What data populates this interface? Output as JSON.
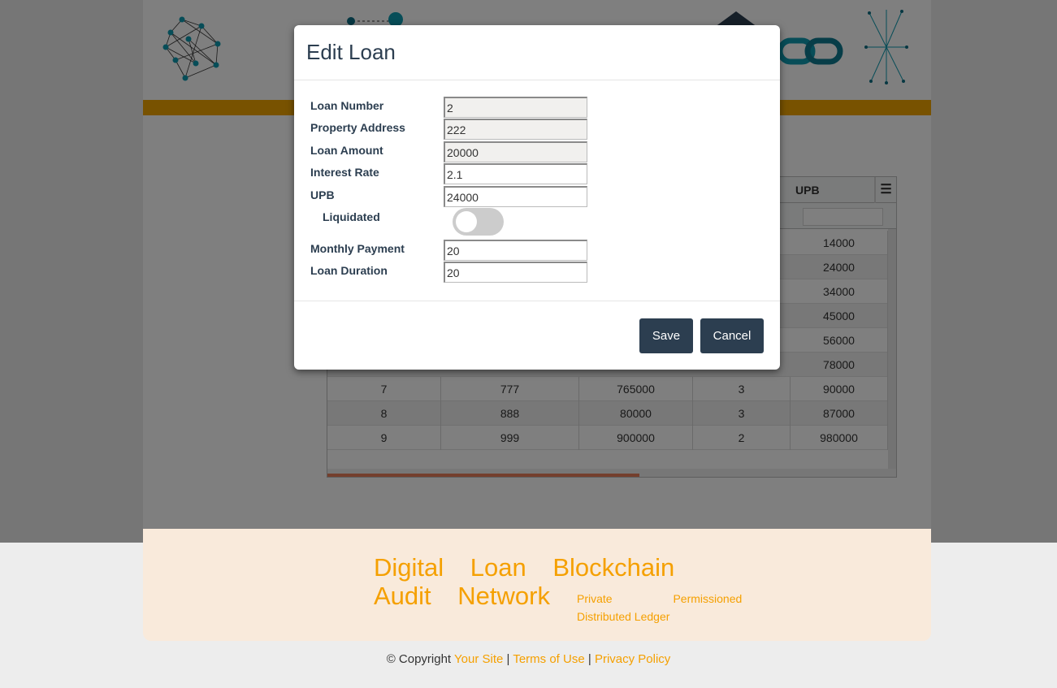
{
  "modal": {
    "title": "Edit Loan",
    "fields": [
      {
        "label": "Loan Number",
        "value": "2"
      },
      {
        "label": "Property Address",
        "value": "222"
      },
      {
        "label": "Loan Amount",
        "value": "20000"
      },
      {
        "label": "Interest Rate",
        "value": "2.1"
      },
      {
        "label": "UPB",
        "value": "24000"
      },
      {
        "label": "Monthly Payment",
        "value": "20"
      },
      {
        "label": "Loan Duration",
        "value": "20"
      }
    ],
    "liquidated_label": "Liquidated",
    "liquidated_on": false,
    "save_label": "Save",
    "cancel_label": "Cancel"
  },
  "grid": {
    "upb_header": "UPB",
    "upb_values": [
      "14000",
      "24000",
      "34000",
      "45000",
      "56000",
      "78000"
    ],
    "rows": [
      [
        "7",
        "777",
        "765000",
        "3",
        "90000"
      ],
      [
        "8",
        "888",
        "80000",
        "3",
        "87000"
      ],
      [
        "9",
        "999",
        "900000",
        "2",
        "980000"
      ]
    ]
  },
  "footer": {
    "brand_line1": "Digital Loan Blockchain",
    "brand_line2": "Audit Network",
    "tagline_1": "Private Permissioned",
    "tagline_2": "Distributed Ledger",
    "copyright": "© Copyright",
    "your_site": "Your Site",
    "terms": "Terms of Use",
    "privacy": "Privacy Policy",
    "separator": "|"
  },
  "colors": {
    "brand_orange": "#f5a000",
    "bar_orange": "#f0a500",
    "navy": "#2c3e50"
  }
}
